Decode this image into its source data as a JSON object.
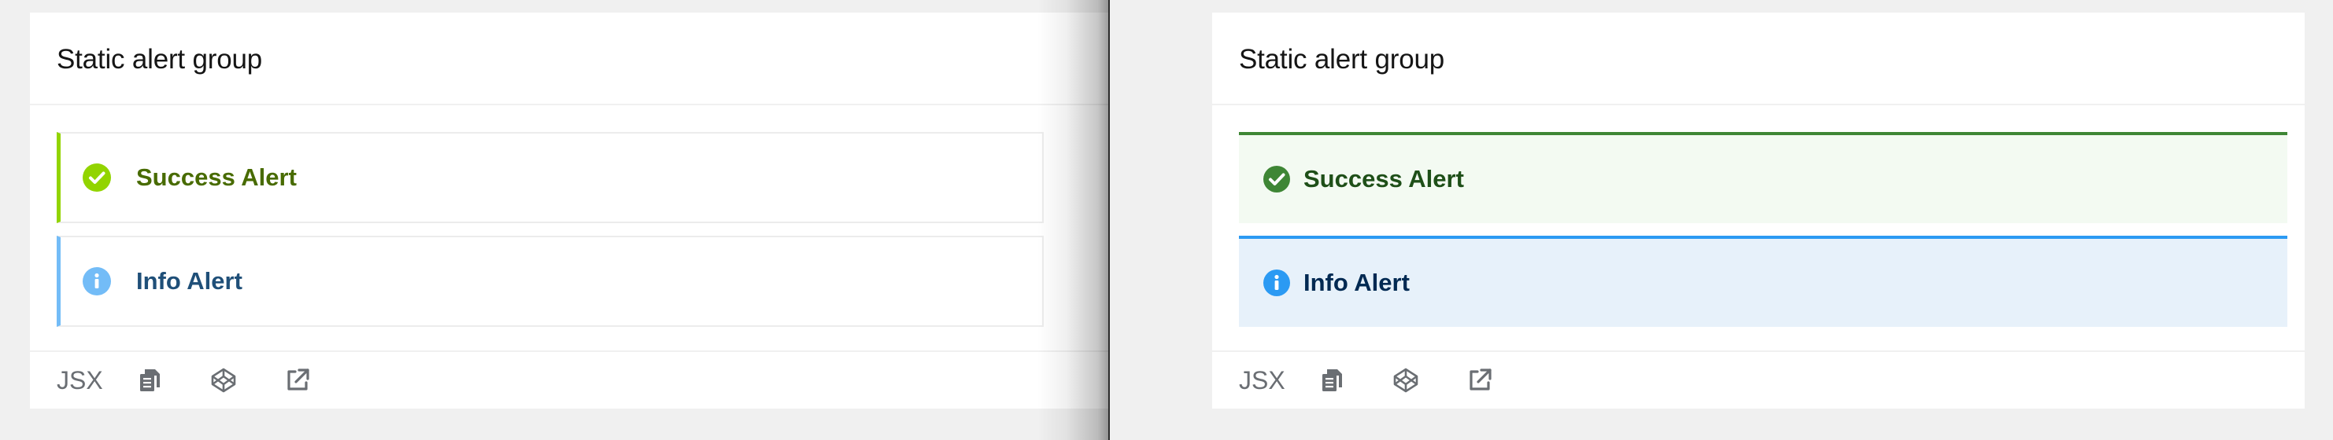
{
  "panels": [
    {
      "card_title": "Static alert group",
      "alerts": [
        {
          "label": "Success Alert",
          "icon": "check-circle-icon",
          "variant": "success"
        },
        {
          "label": "Info Alert",
          "icon": "info-circle-icon",
          "variant": "info"
        }
      ],
      "toolbar": {
        "jsx_label": "JSX",
        "icons": [
          "copy-icon",
          "codepen-icon",
          "external-link-icon"
        ]
      }
    },
    {
      "card_title": "Static alert group",
      "alerts": [
        {
          "label": "Success Alert",
          "icon": "check-circle-icon",
          "variant": "success"
        },
        {
          "label": "Info Alert",
          "icon": "info-circle-icon",
          "variant": "info"
        }
      ],
      "toolbar": {
        "jsx_label": "JSX",
        "icons": [
          "copy-icon",
          "codepen-icon",
          "external-link-icon"
        ]
      }
    }
  ],
  "colors": {
    "left_success_border": "#92d400",
    "left_success_text": "#486b00",
    "left_info_border": "#73bcf7",
    "left_info_text": "#1f4f78",
    "right_success_border": "#3e8635",
    "right_success_bg": "#f3faf2",
    "right_info_border": "#2b9af3",
    "right_info_bg": "#e7f1fa",
    "toolbar_icon": "#6a6e73"
  }
}
